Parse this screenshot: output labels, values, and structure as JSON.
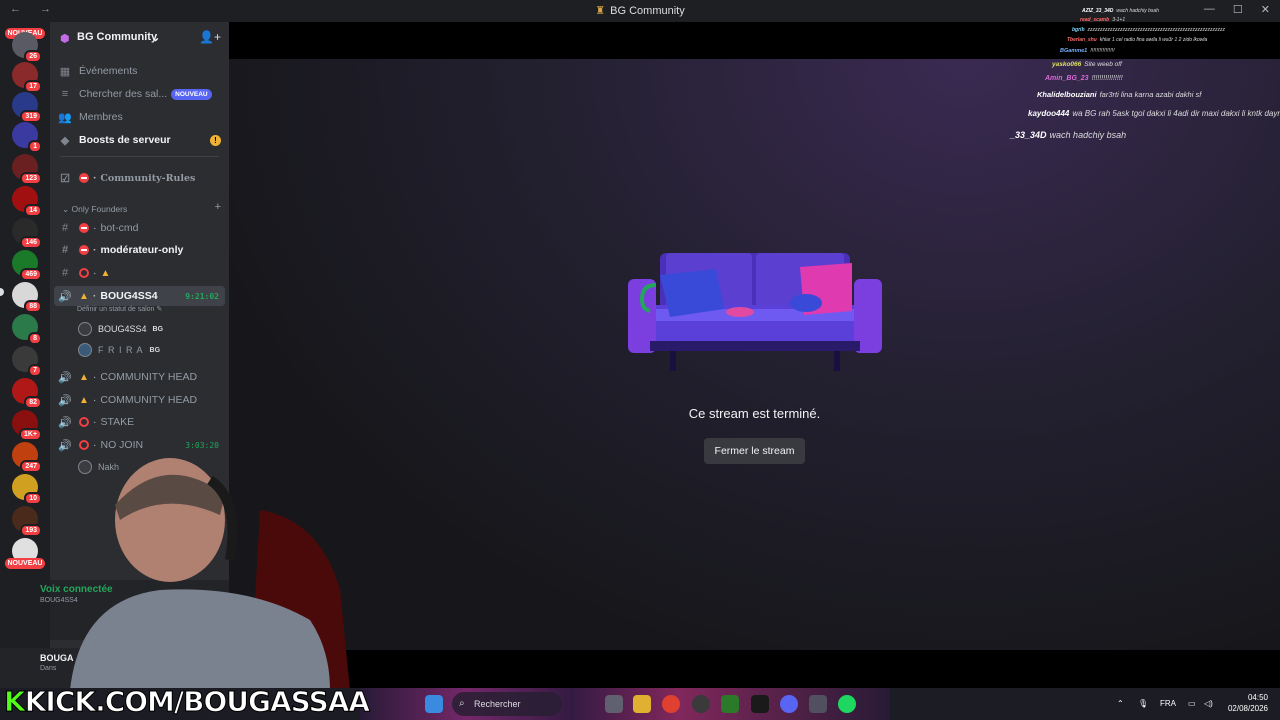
{
  "window": {
    "title": "BG Community"
  },
  "rail": {
    "new_badge": "NOUVEAU",
    "counts": [
      "26",
      "17",
      "319",
      "1",
      "123",
      "14",
      "146",
      "469",
      "88",
      "8",
      "7",
      "82",
      "1K+",
      "247",
      "10",
      "193"
    ],
    "new_badge_bottom": "NOUVEAU"
  },
  "server": {
    "name": "BG Community"
  },
  "menu": {
    "events": "Événements",
    "browse": "Chercher des sal...",
    "browse_badge": "NOUVEAU",
    "members": "Membres",
    "boosts": "Boosts de serveur",
    "boosts_alert": "!"
  },
  "channels": {
    "rules": "Community-Rules",
    "category": "Only Founders",
    "bot_cmd": "bot-cmd",
    "mod_only": "modérateur-only",
    "voice_active": "BOUG4SS4",
    "voice_active_time": "9:21:02",
    "voice_status_hint": "Définir un statut de salon",
    "members_in_voice": [
      {
        "name": "BOUG4SS4",
        "tag": "BG"
      },
      {
        "name": "F R I R A",
        "tag": "BG"
      }
    ],
    "head1": "COMMUNITY HEAD",
    "head2": "COMMUNITY HEAD",
    "stake": "STAKE",
    "no_join": "NO JOIN",
    "no_join_time": "3:03:20",
    "no_join_member": "Nakh"
  },
  "voice_panel": {
    "label": "Voix connectée",
    "server": "BOUG4SS4"
  },
  "user_panel": {
    "name": "BOUGA",
    "status": "Dans"
  },
  "stage": {
    "ended_text": "Ce stream est terminé.",
    "close_button": "Fermer le stream"
  },
  "chat_overlay": [
    {
      "user": "AZIZ_33_34D",
      "msg": "wach hadchiy bsah",
      "color": "#ffffff"
    },
    {
      "user": "read_scamb",
      "msg": "3-1+1",
      "color": "#ff6a6a"
    },
    {
      "user": "bgrib",
      "msg": "zzzzzzzzzzzzzzzzzzzzzzzzzzzzzzzzzzzzzzzzzzzzzzzzzzzzzzz",
      "color": "#7ad9ff"
    },
    {
      "user": "Tberlan_shu",
      "msg": "khlar 1 cel radio fina awila li wa3r 1 2 zido lkowla",
      "color": "#ff6a6a"
    },
    {
      "user": "BGamme1",
      "msg": "!!!!!!!!!!!!!!!!",
      "color": "#7ab0ff"
    },
    {
      "user": "yasko066",
      "msg": "Site weeb off",
      "color": "#e0e060"
    },
    {
      "user": "Amin_BG_23",
      "msg": "!!!!!!!!!!!!!!!!",
      "color": "#d86ad8"
    },
    {
      "user": "Khalidelbouziani",
      "msg": "far3rti lina karna azabi dakhi sf",
      "color": "#ffffff"
    },
    {
      "user": "kaydoo444",
      "msg": "wa BG rah 5ask tgol dakxi li 4adi dir maxi dakxi li kntk dayr",
      "color": "#ffffff"
    },
    {
      "user": "_33_34D",
      "msg": "wach hadchiy bsah",
      "color": "#ffffff"
    }
  ],
  "watermark": {
    "k": "K",
    "text": "KICK.COM/BOUGASSAA"
  },
  "taskbar": {
    "search": "Rechercher",
    "lang": "FRA",
    "time": "04:50",
    "date": "02/08/2026"
  },
  "colors": {
    "accent": "#5865f2",
    "voice": "#23a55a",
    "danger": "#f23f43",
    "warning": "#f0b232",
    "kick": "#53fc18"
  }
}
